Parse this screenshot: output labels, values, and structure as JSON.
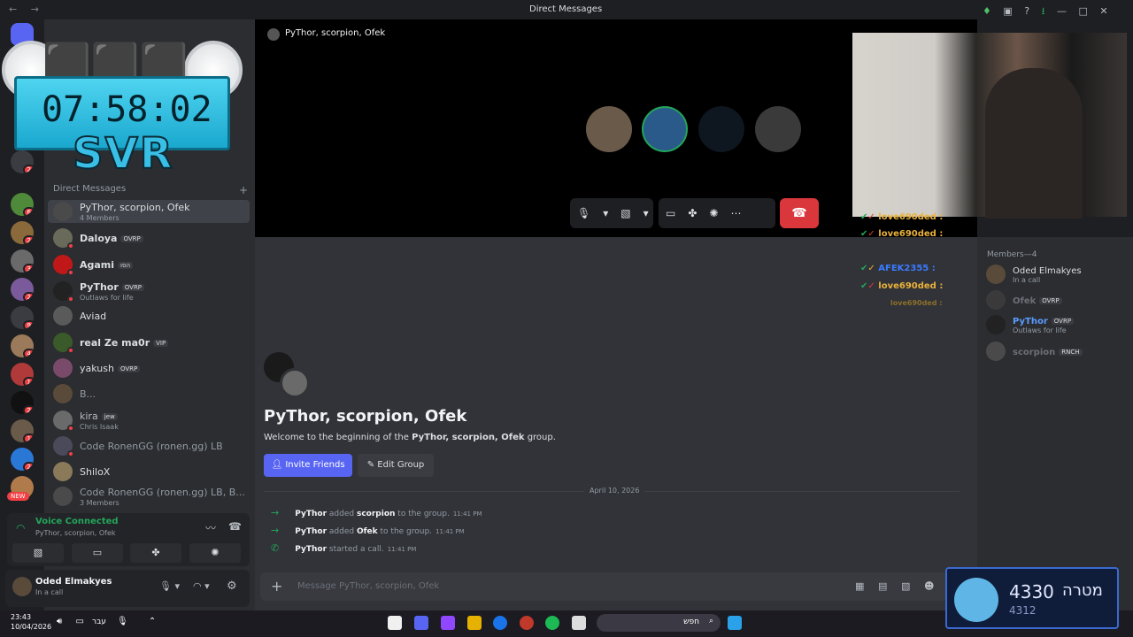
{
  "window": {
    "title": "Direct Messages"
  },
  "overlay": {
    "time": "07:58:02",
    "svr": "SVR"
  },
  "dm_list": {
    "header": "Direct Messages",
    "items": [
      {
        "name": "PyThor, scorpion, Ofek",
        "sub": "4 Members",
        "tag": ""
      },
      {
        "name": "Daloya",
        "sub": "",
        "tag": "OVRP"
      },
      {
        "name": "Agami",
        "sub": "",
        "tag": "הסו"
      },
      {
        "name": "PyThor",
        "sub": "Outlaws for life",
        "tag": "OVRP"
      },
      {
        "name": "Aviad",
        "sub": "",
        "tag": ""
      },
      {
        "name": "real Ze ma0r",
        "sub": "",
        "tag": "VIP"
      },
      {
        "name": "yakush",
        "sub": "",
        "tag": "OVRP"
      },
      {
        "name": "B...",
        "sub": "",
        "tag": ""
      },
      {
        "name": "kira",
        "sub": "Chris Isaak",
        "tag": "jew"
      },
      {
        "name": "Code RonenGG (ronen.gg) LB",
        "sub": "",
        "tag": ""
      },
      {
        "name": "ShiloX",
        "sub": "",
        "tag": ""
      },
      {
        "name": "Code RonenGG (ronen.gg) LB, B...",
        "sub": "3 Members",
        "tag": ""
      }
    ]
  },
  "server_badges": [
    "2",
    "6",
    "2",
    "3",
    "2",
    "9",
    "4",
    "1",
    "2",
    "1",
    "2"
  ],
  "new_badge": "NEW",
  "voice": {
    "title": "Voice Connected",
    "channel": "PyThor, scorpion, Ofek"
  },
  "user": {
    "name": "Oded Elmakyes",
    "status": "In a call"
  },
  "call": {
    "title": "PyThor, scorpion, Ofek"
  },
  "stream_chat": [
    {
      "name": "love690ded :",
      "color": "#e9b23a"
    },
    {
      "name": "love690ded :",
      "color": "#e9b23a"
    },
    {
      "name": "AFEK2355 :",
      "color": "#3a7bff"
    },
    {
      "name": "love690ded :",
      "color": "#e9b23a"
    },
    {
      "name": "love690ded :",
      "color": "#8c6f2a"
    }
  ],
  "group": {
    "title": "PyThor, scorpion, Ofek",
    "welcome_pre": "Welcome to the beginning of the ",
    "welcome_name": "PyThor, scorpion, Ofek",
    "welcome_post": " group.",
    "invite": "Invite Friends",
    "edit": "Edit Group",
    "date": "April 10, 2026"
  },
  "messages": [
    {
      "actor": "PyThor",
      "verb": "added",
      "target": "scorpion",
      "rest": "to the group.",
      "time": "11:41 PM"
    },
    {
      "actor": "PyThor",
      "verb": "added",
      "target": "Ofek",
      "rest": "to the group.",
      "time": "11:41 PM"
    },
    {
      "actor": "PyThor",
      "verb": "started a call.",
      "target": "",
      "rest": "",
      "time": "11:41 PM"
    }
  ],
  "composer": {
    "placeholder": "Message PyThor, scorpion, Ofek"
  },
  "members": {
    "header": "Members—4",
    "items": [
      {
        "name": "Oded Elmakyes",
        "sub": "In a call",
        "tag": ""
      },
      {
        "name": "Ofek",
        "sub": "",
        "tag": "OVRP"
      },
      {
        "name": "PyThor",
        "sub": "Outlaws for life",
        "tag": "OVRP"
      },
      {
        "name": "scorpion",
        "sub": "",
        "tag": "RNCH"
      }
    ]
  },
  "taskbar": {
    "time": "23:43",
    "date": "10/04/2026",
    "lang": "עבר",
    "search": "חפש"
  },
  "score": {
    "value": "4330",
    "label": "מטרה",
    "sub": "4312"
  }
}
